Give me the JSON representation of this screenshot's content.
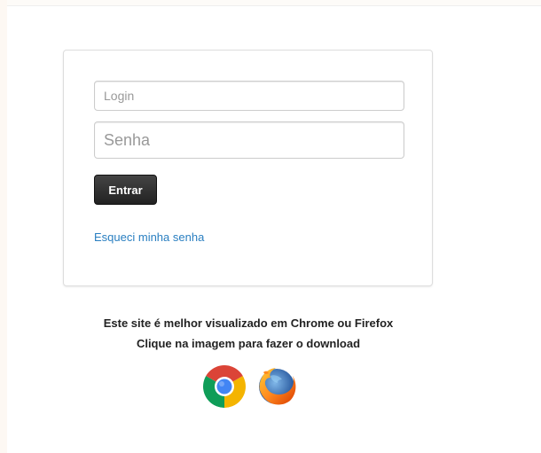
{
  "login_form": {
    "login_placeholder": "Login",
    "login_value": "",
    "password_placeholder": "Senha",
    "password_value": "",
    "submit_label": "Entrar",
    "forgot_link": "Esqueci minha senha"
  },
  "browser_notice": {
    "line1": "Este site é melhor visualizado em Chrome ou Firefox",
    "line2": "Clique na imagem para fazer o download",
    "icons": [
      "chrome-icon",
      "firefox-icon"
    ]
  },
  "colors": {
    "link": "#2a7fc1",
    "button": "#222222",
    "panel_border": "#dddddd"
  }
}
